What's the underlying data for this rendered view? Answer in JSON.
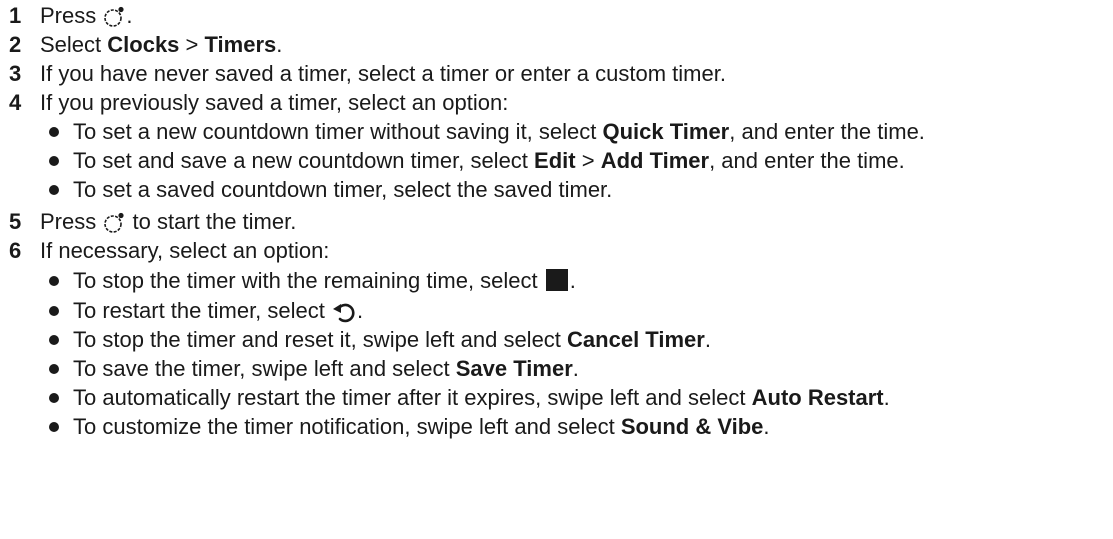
{
  "steps": [
    {
      "num": "1",
      "pre": "Press",
      "post": "."
    },
    {
      "num": "2",
      "pre": "Select ",
      "b1": "Clocks",
      "mid": " > ",
      "b2": "Timers",
      "post": "."
    },
    {
      "num": "3",
      "text": "If you have never saved a timer, select a timer or enter a custom timer."
    },
    {
      "num": "4",
      "text": "If you previously saved a timer, select an option:"
    },
    {
      "num": "5",
      "pre": "Press",
      "post": "to start the timer."
    },
    {
      "num": "6",
      "text": "If necessary, select an option:"
    }
  ],
  "options_a": [
    {
      "pre": "To set a new countdown timer without saving it, select ",
      "b1": "Quick Timer",
      "post": ", and enter the time."
    },
    {
      "pre": "To set and save a new countdown timer, select ",
      "b1": "Edit",
      "mid": " > ",
      "b2": "Add Timer",
      "post": ", and enter the time."
    },
    {
      "pre": "To set a saved countdown timer, select the saved timer."
    }
  ],
  "options_b": [
    {
      "pre": "To stop the timer with the remaining time, select",
      "post": "."
    },
    {
      "pre": "To restart the timer, select",
      "post": "."
    },
    {
      "pre": "To stop the timer and reset it, swipe left and select ",
      "b1": "Cancel Timer",
      "post": "."
    },
    {
      "pre": "To save the timer, swipe left and select ",
      "b1": "Save Timer",
      "post": "."
    },
    {
      "pre": "To automatically restart the timer after it expires, swipe left and select ",
      "b1": "Auto Restart",
      "post": "."
    },
    {
      "pre": "To customize the timer notification, swipe left and select ",
      "b1": "Sound & Vibe",
      "post": "."
    }
  ],
  "icons": {
    "button": "watch-button-icon",
    "stop": "stop-icon",
    "restart": "restart-icon"
  }
}
